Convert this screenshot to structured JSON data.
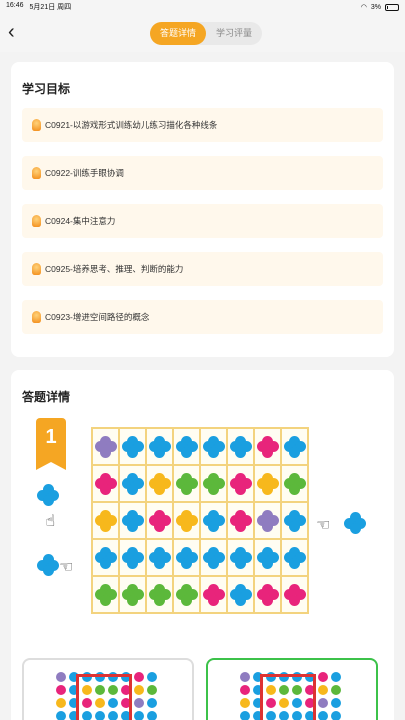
{
  "status": {
    "time": "16:46",
    "date": "5月21日 周四",
    "battery": "3%"
  },
  "nav": {
    "back": "‹",
    "tabs": [
      {
        "label": "答题详情",
        "active": true
      },
      {
        "label": "学习评量",
        "active": false
      }
    ]
  },
  "goals": {
    "title": "学习目标",
    "items": [
      "C0921-以游戏形式训练幼儿练习描化各种线条",
      "C0922-训练手眼协调",
      "C0924-集中注意力",
      "C0925-培养思考、推理、判断的能力",
      "C0923-增进空间路径的概念"
    ]
  },
  "details": {
    "title": "答题详情",
    "question_number": "1",
    "colors": {
      "P": "#8f7cc0",
      "B": "#1a9fe0",
      "R": "#e8247b",
      "Y": "#f7b81c",
      "G": "#5cb83b"
    },
    "grid": [
      [
        "P",
        "B",
        "B",
        "B",
        "B",
        "B",
        "R",
        "B"
      ],
      [
        "R",
        "B",
        "Y",
        "G",
        "G",
        "R",
        "Y",
        "G"
      ],
      [
        "Y",
        "B",
        "R",
        "Y",
        "B",
        "R",
        "P",
        "B"
      ],
      [
        "B",
        "B",
        "B",
        "B",
        "B",
        "B",
        "B",
        "B"
      ],
      [
        "G",
        "G",
        "G",
        "G",
        "R",
        "B",
        "R",
        "R"
      ]
    ]
  }
}
